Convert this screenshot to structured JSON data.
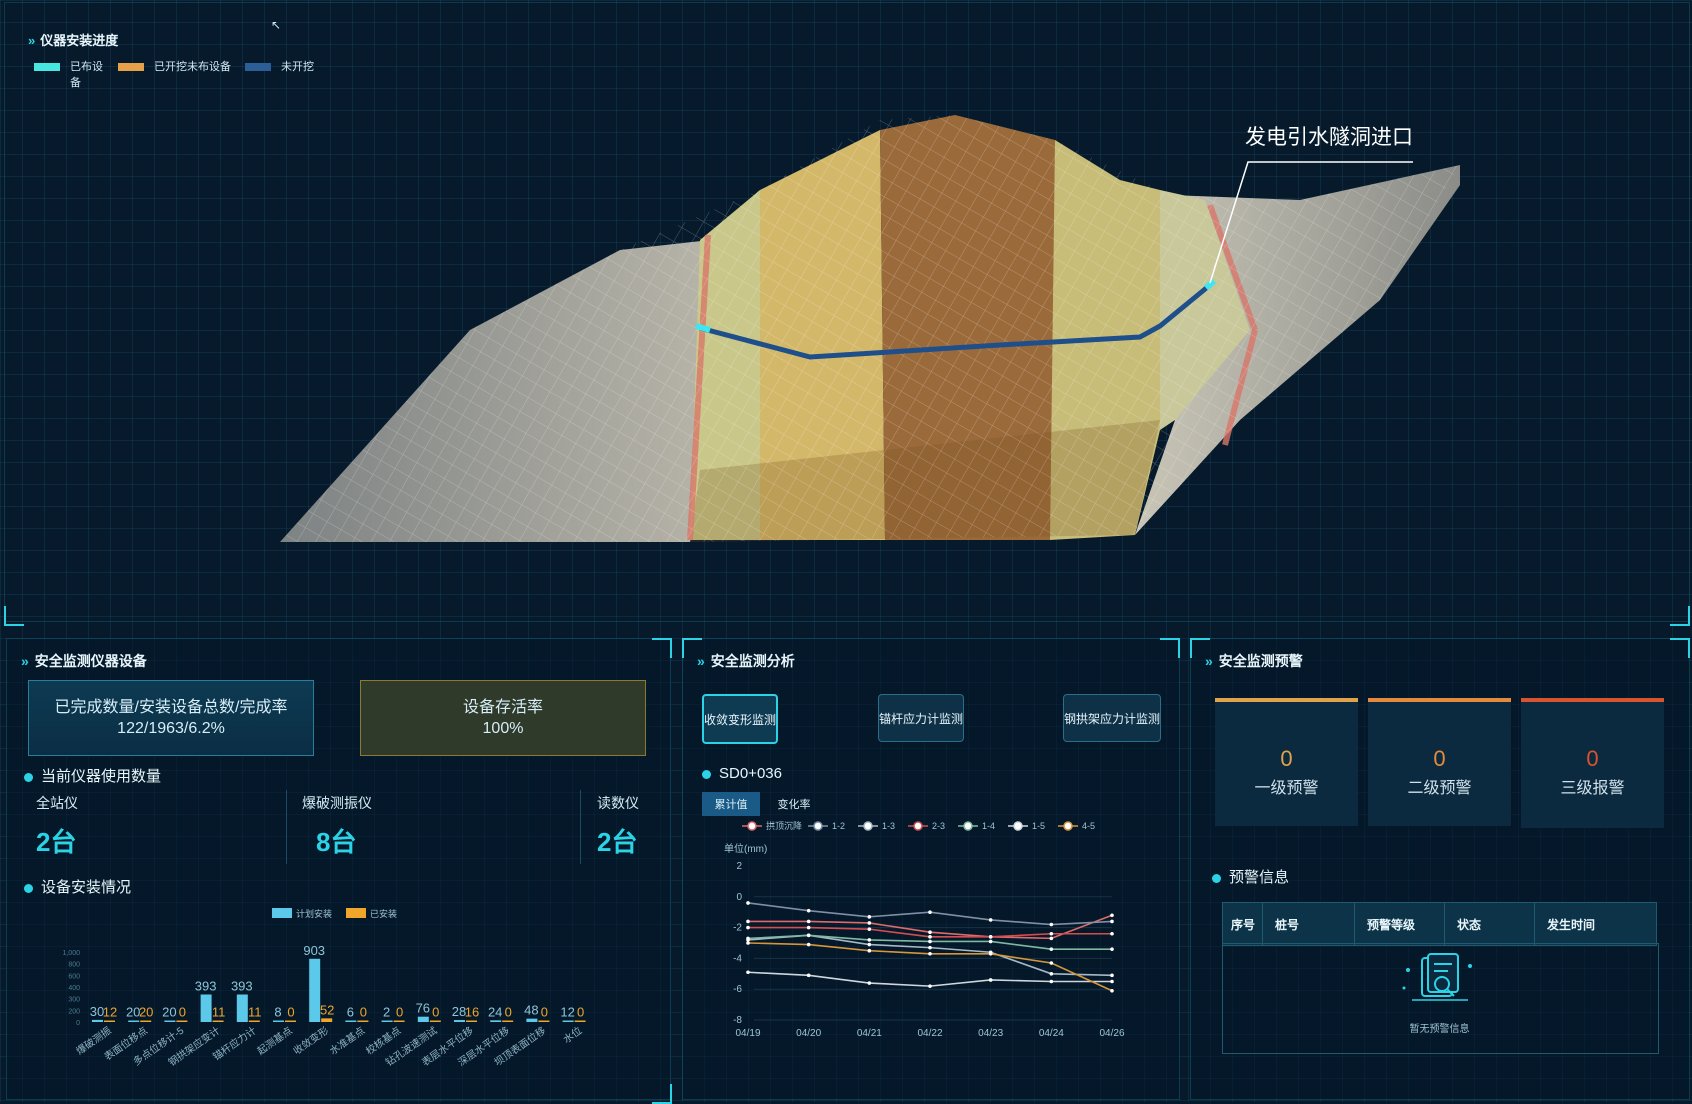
{
  "install_progress": {
    "title": "仪器安装进度",
    "legend": [
      {
        "label": "已布设备",
        "color": "#48e6e1"
      },
      {
        "label": "已开挖未布设备",
        "color": "#e6a04a"
      },
      {
        "label": "未开挖",
        "color": "#2b5d96"
      }
    ],
    "tunnel_label": "发电引水隧洞进口"
  },
  "devices_panel": {
    "title": "安全监测仪器设备",
    "completion": {
      "label": "已完成数量/安装设备总数/完成率",
      "value": "122/1963/6.2%"
    },
    "survival": {
      "label": "设备存活率",
      "value": "100%"
    },
    "usage_title": "当前仪器使用数量",
    "usage": [
      {
        "label": "全站仪",
        "value": "2台"
      },
      {
        "label": "爆破测振仪",
        "value": "8台"
      },
      {
        "label": "读数仪",
        "value": "2台"
      }
    ],
    "install_title": "设备安装情况"
  },
  "analysis_panel": {
    "title": "安全监测分析",
    "buttons": [
      "收敛变形监测",
      "锚杆应力计监测",
      "钢拱架应力计监测"
    ],
    "station": "SD0+036",
    "tabs": [
      "累计值",
      "变化率"
    ],
    "unit": "单位(mm)"
  },
  "warning_panel": {
    "title": "安全监测预警",
    "cards": [
      {
        "count": "0",
        "label": "一级预警",
        "color": "#e0a24a"
      },
      {
        "count": "0",
        "label": "二级预警",
        "color": "#e58a3c"
      },
      {
        "count": "0",
        "label": "三级报警",
        "color": "#d9532e"
      }
    ],
    "info_title": "预警信息",
    "columns": [
      "序号",
      "桩号",
      "预警等级",
      "状态",
      "发生时间"
    ],
    "empty_text": "暂无预警信息"
  },
  "chart_data": [
    {
      "type": "bar",
      "title": "",
      "legend": [
        {
          "name": "计划安装",
          "color": "#5cc8ea"
        },
        {
          "name": "已安装",
          "color": "#f0a52b"
        }
      ],
      "categories": [
        "爆破测振",
        "表面位移点",
        "多点位移计-5",
        "钢拱架应变计",
        "锚杆应力计",
        "起测基点",
        "收敛变形",
        "水准基点",
        "校核基点",
        "钻孔波速测试",
        "表层水平位移",
        "深层水平位移",
        "坝顶表面位移",
        "水位"
      ],
      "series": [
        {
          "name": "计划安装",
          "values": [
            30,
            20,
            20,
            393,
            393,
            8,
            903,
            6,
            2,
            76,
            28,
            24,
            48,
            12
          ]
        },
        {
          "name": "已安装",
          "values": [
            12,
            20,
            0,
            11,
            11,
            0,
            52,
            0,
            0,
            0,
            16,
            0,
            0,
            0
          ]
        }
      ],
      "y_ticks": [
        "0",
        "200",
        "300",
        "400",
        "600",
        "800",
        "1,000"
      ],
      "ylim": [
        0,
        1000
      ]
    },
    {
      "type": "line",
      "ylabel": "单位(mm)",
      "x": [
        "04/19",
        "04/20",
        "04/21",
        "04/22",
        "04/23",
        "04/24",
        "04/26"
      ],
      "ylim": [
        -8,
        2
      ],
      "y_ticks": [
        2,
        0,
        -2,
        -4,
        -6,
        -8
      ],
      "series": [
        {
          "name": "拱顶沉降",
          "color": "#e06a6a",
          "values": [
            -1.6,
            -1.6,
            -1.7,
            -2.3,
            -2.6,
            -2.7,
            -1.2
          ]
        },
        {
          "name": "1-2",
          "color": "#7f8fa6",
          "values": [
            -0.4,
            -0.9,
            -1.3,
            -1.0,
            -1.5,
            -1.8,
            -1.6
          ]
        },
        {
          "name": "1-3",
          "color": "#a7b8c6",
          "values": [
            -2.8,
            -2.5,
            -3.1,
            -3.3,
            -3.6,
            -5.0,
            -5.1
          ]
        },
        {
          "name": "2-3",
          "color": "#d24f4f",
          "values": [
            -2.0,
            -2.0,
            -2.1,
            -2.6,
            -2.6,
            -2.4,
            -2.4
          ]
        },
        {
          "name": "1-4",
          "color": "#7fb9a0",
          "values": [
            -2.7,
            -2.5,
            -2.8,
            -2.9,
            -2.9,
            -3.4,
            -3.4
          ]
        },
        {
          "name": "1-5",
          "color": "#cfd6de",
          "values": [
            -4.9,
            -5.1,
            -5.6,
            -5.8,
            -5.4,
            -5.5,
            -5.5
          ]
        },
        {
          "name": "4-5",
          "color": "#d6963a",
          "values": [
            -3.0,
            -3.1,
            -3.5,
            -3.7,
            -3.7,
            -4.3,
            -6.1
          ]
        }
      ]
    }
  ]
}
